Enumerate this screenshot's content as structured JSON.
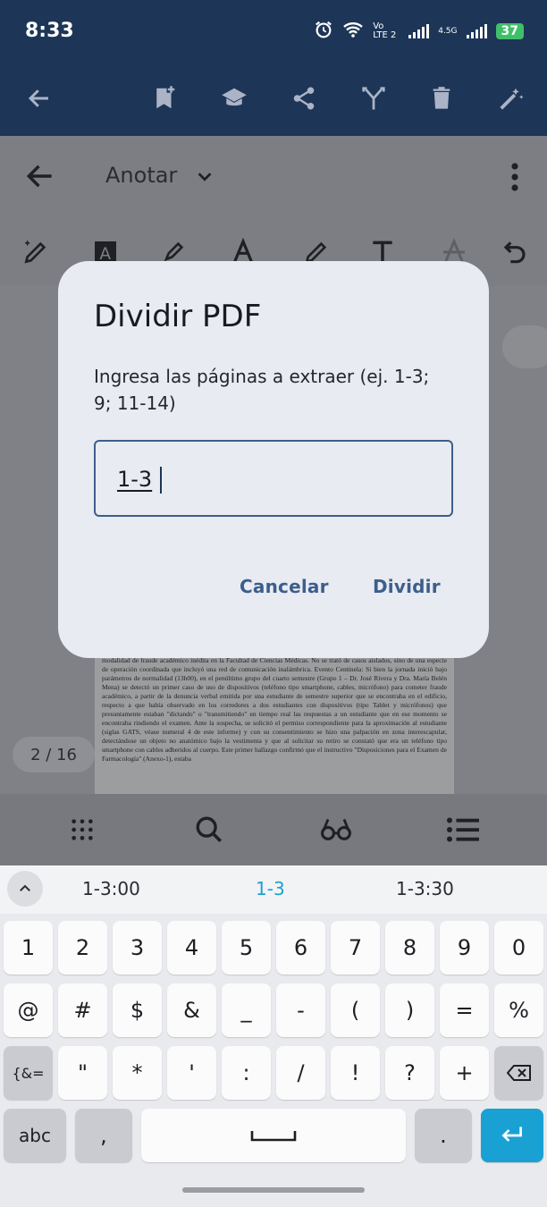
{
  "status_bar": {
    "time": "8:33",
    "network_label": "Vo LTE 2",
    "network2_label": "4.5G",
    "battery": "37"
  },
  "top_toolbar": {
    "icons": [
      "back-arrow-icon",
      "bookmark-add-icon",
      "graduation-cap-icon",
      "share-icon",
      "merge-icon",
      "trash-icon",
      "magic-wand-icon"
    ]
  },
  "annotate_bar": {
    "mode_label": "Anotar",
    "tools": [
      "ai-pen-icon",
      "text-highlight-icon",
      "highlighter-icon",
      "text-color-icon",
      "pen-icon",
      "text-icon",
      "strikethrough-icon",
      "undo-icon"
    ]
  },
  "pdf_preview": {
    "text": "modalidad de fraude académico inédita en la Facultad de Ciencias Médicas. No se trató de casos aislados, sino de una especie de operación coordinada que incluyó una red de comunicación inalámbrica. Evento Centinela: Si bien la jornada inició bajo parámetros de normalidad (13h00), en el penúltimo grupo del cuarto semestre (Grupo 1 – Dr. José Rivera y Dra. María Belén Mena) se detectó un primer caso de uso de dispositivos (teléfono tipo smartphone, cables, micrófono) para cometer fraude académico, a partir de la denuncia verbal emitida por una estudiante de semestre superior que se encontraba en el edificio, respecto a que había observado en los corredores a dos estudiantes con dispositivos (tipo Tablet y micrófonos) que presuntamente estaban \"dictando\" o \"transmitiendo\" en tiempo real las respuestas a un estudiante que en ese momento se encontraba rindiendo el examen. Ante la sospecha, se solicitó el permiso correspondiente para la aproximación al estudiante (siglas GATS, véase numeral 4 de este informe) y con su consentimiento se hizo una palpación en zona interescapular, detectándose un objeto no anatómico bajo la vestimenta y que al solicitar su retiro se constató que era un teléfono tipo smartphone con cables adheridos al cuerpo. Este primer hallazgo confirmó que el instructivo \"Disposiciones para el Examen de Farmacología\" (Anexo-1), estaba",
    "page_counter": "2 / 16"
  },
  "bottom_bar": {
    "icons": [
      "grid-icon",
      "search-icon",
      "reading-glasses-icon",
      "list-icon"
    ]
  },
  "dialog": {
    "title": "Dividir PDF",
    "message": "Ingresa las páginas a extraer (ej. 1-3; 9; 11-14)",
    "input_value": "1-3",
    "cancel_label": "Cancelar",
    "confirm_label": "Dividir"
  },
  "suggestions": [
    "1-3:00",
    "1-3",
    "1-3:30"
  ],
  "keyboard": {
    "row1": [
      "1",
      "2",
      "3",
      "4",
      "5",
      "6",
      "7",
      "8",
      "9",
      "0"
    ],
    "row2": [
      "@",
      "#",
      "$",
      "&",
      "_",
      "-",
      "(",
      ")",
      "=",
      "%"
    ],
    "row3": [
      "{&=",
      "\"",
      "*",
      "'",
      ":",
      "/",
      "!",
      "?",
      "+"
    ],
    "row4": [
      "abc",
      ",",
      ".",
      ""
    ]
  },
  "colors": {
    "toolbar": "#1d3557",
    "dialog_bg": "#e8ebf1",
    "accent": "#3d5e8c",
    "suggestion_active": "#1aa1d4",
    "enter_key": "#1aa1d4"
  }
}
